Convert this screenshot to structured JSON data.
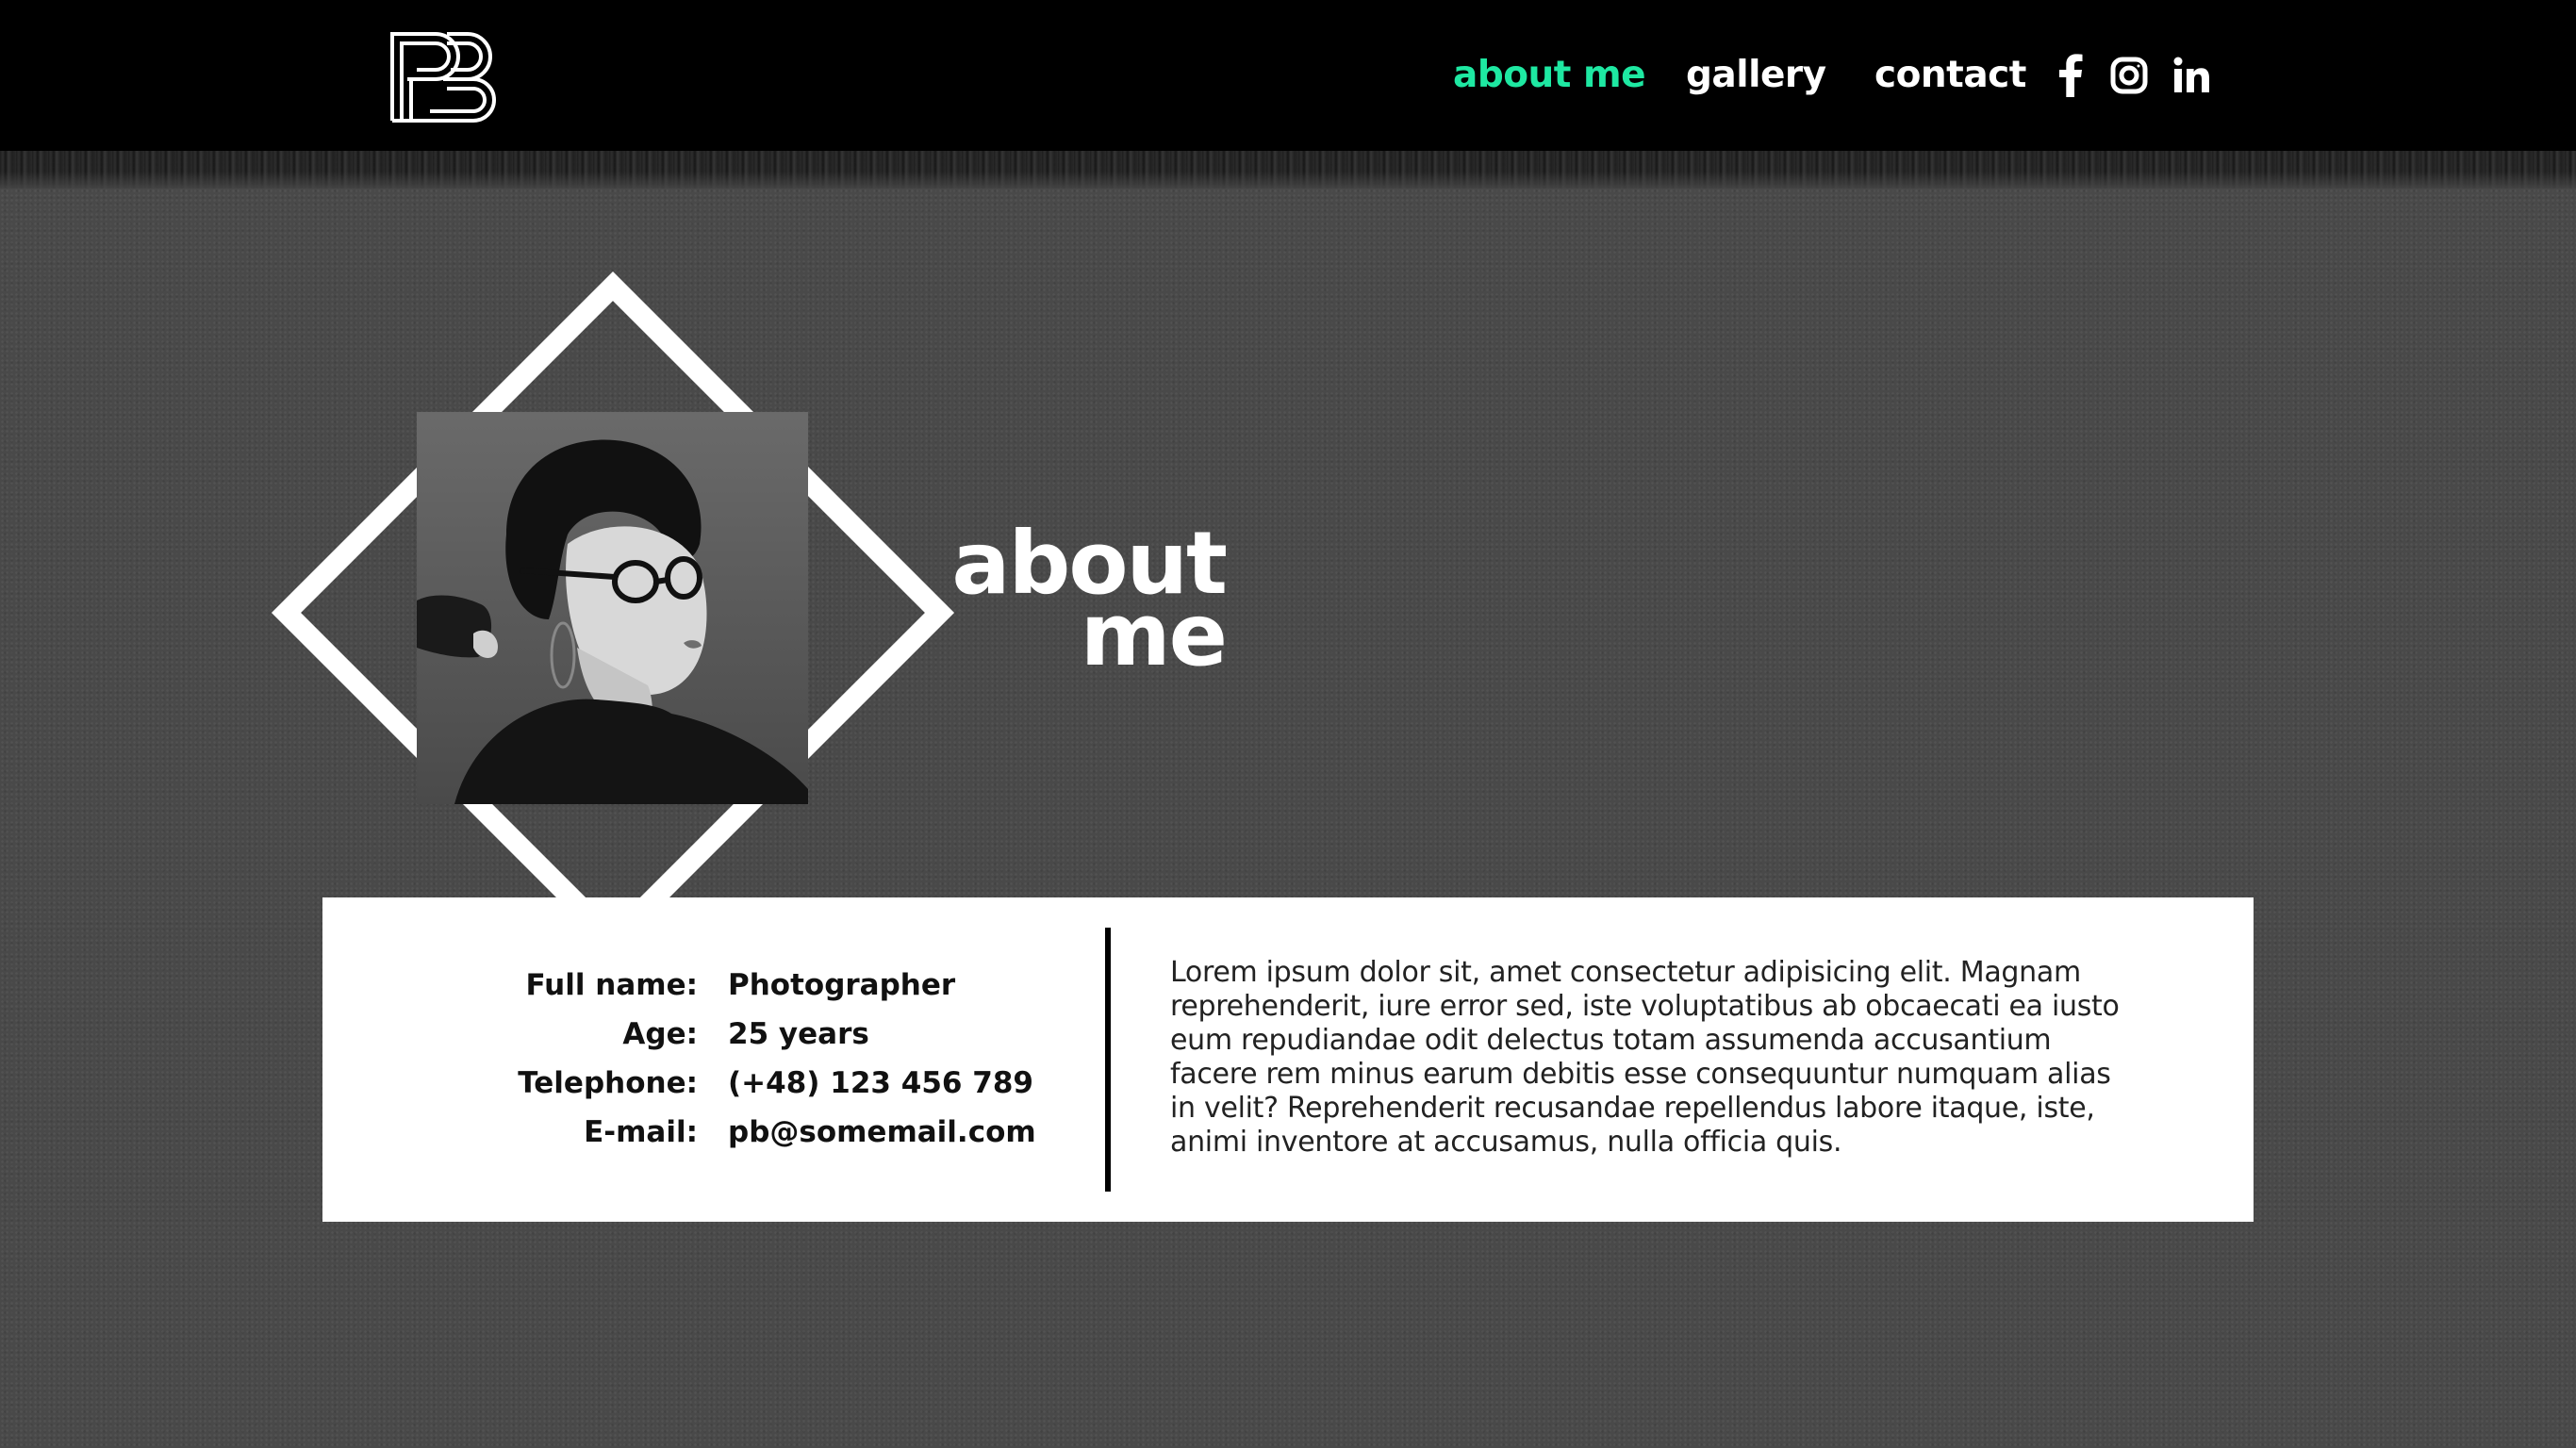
{
  "header": {
    "logo_text": "PB",
    "nav": [
      {
        "label": "about me",
        "active": true
      },
      {
        "label": "gallery",
        "active": false
      },
      {
        "label": "contact",
        "active": false
      }
    ],
    "social": [
      "facebook-icon",
      "instagram-icon",
      "linkedin-icon"
    ],
    "active_color": "#1ee8a2"
  },
  "hero": {
    "title_line1": "about",
    "title_line2": "me",
    "photo_description_icon": "portrait-photo"
  },
  "info": {
    "rows": [
      {
        "label": "Full name:",
        "value": "Photographer"
      },
      {
        "label": "Age:",
        "value": "25 years"
      },
      {
        "label": "Telephone:",
        "value": "(+48) 123 456 789"
      },
      {
        "label": "E-mail:",
        "value": "pb@somemail.com"
      }
    ],
    "bio": "Lorem ipsum dolor sit, amet consectetur adipisicing elit. Magnam reprehenderit, iure error sed, iste voluptatibus ab obcaecati ea iusto eum repudiandae odit delectus totam assumenda accusantium facere rem minus earum debitis esse consequuntur numquam alias in velit? Reprehenderit recusandae repellendus labore itaque, iste, animi inventore at accusamus, nulla officia quis."
  }
}
